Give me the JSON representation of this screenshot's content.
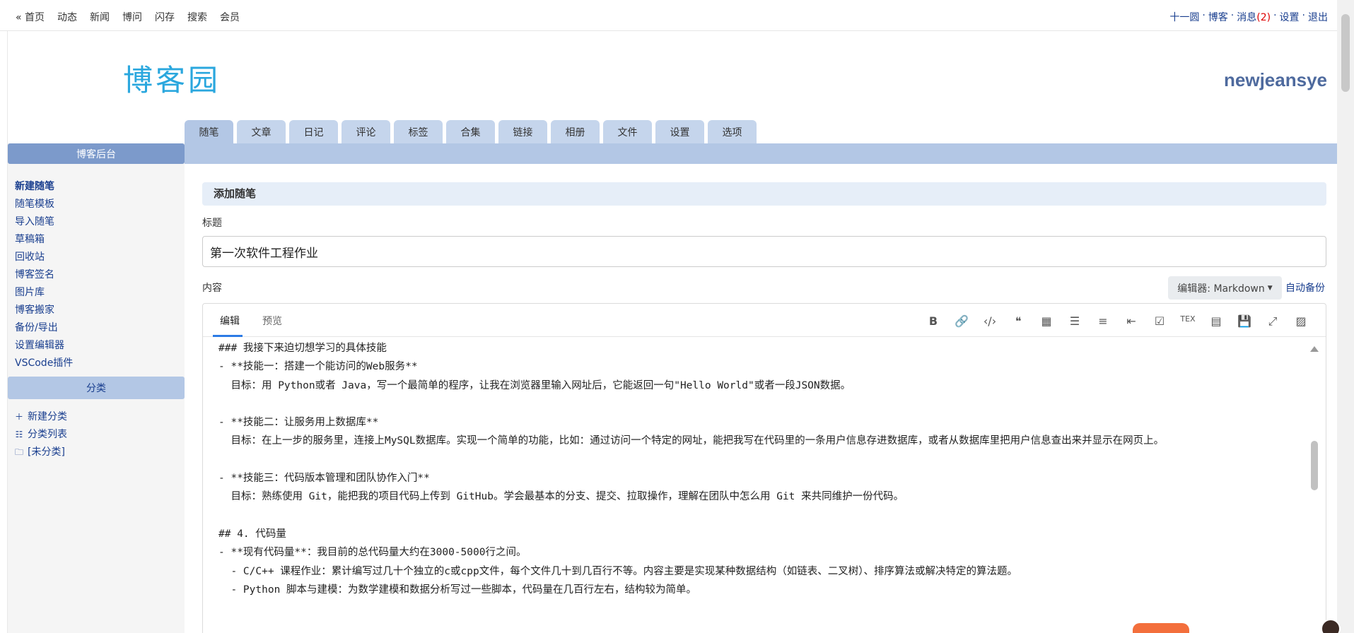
{
  "topbar": {
    "left": [
      "« 首页",
      "动态",
      "新闻",
      "博问",
      "闪存",
      "搜索",
      "会员"
    ],
    "right": {
      "user": "十一圆",
      "blog": "博客",
      "messages": "消息",
      "messages_count": "(2)",
      "settings": "设置",
      "logout": "退出",
      "sep": "·"
    }
  },
  "header": {
    "logo": "博客园",
    "username": "newjeansye"
  },
  "tabs": [
    "随笔",
    "文章",
    "日记",
    "评论",
    "标签",
    "合集",
    "链接",
    "相册",
    "文件",
    "设置",
    "选项"
  ],
  "sidebar": {
    "title": "博客后台",
    "links": [
      "新建随笔",
      "随笔模板",
      "导入随笔",
      "草稿箱",
      "回收站",
      "博客签名",
      "图片库",
      "博客搬家",
      "备份/导出",
      "设置编辑器",
      "VSCode插件"
    ],
    "category_title": "分类",
    "categories": [
      {
        "icon": "plus-icon",
        "label": "新建分类"
      },
      {
        "icon": "list-icon",
        "label": "分类列表"
      },
      {
        "icon": "folder-icon",
        "label": "[未分类]"
      }
    ]
  },
  "main": {
    "section_title": "添加随笔",
    "title_label": "标题",
    "title_value": "第一次软件工程作业",
    "content_label": "内容",
    "editor_select": "编辑器: Markdown",
    "autosave": "自动备份",
    "editor_tabs": [
      "编辑",
      "预览"
    ],
    "toolbar": [
      {
        "name": "bold-icon",
        "glyph": "B"
      },
      {
        "name": "link-icon",
        "glyph": "🔗"
      },
      {
        "name": "code-icon",
        "glyph": "‹/›"
      },
      {
        "name": "quote-icon",
        "glyph": "❝"
      },
      {
        "name": "table-icon",
        "glyph": "▦"
      },
      {
        "name": "unordered-list-icon",
        "glyph": "☰"
      },
      {
        "name": "ordered-list-icon",
        "glyph": "≡"
      },
      {
        "name": "indent-icon",
        "glyph": "⇤"
      },
      {
        "name": "task-list-icon",
        "glyph": "☑"
      },
      {
        "name": "tex-icon",
        "glyph": "TEX"
      },
      {
        "name": "toc-icon",
        "glyph": "▤"
      },
      {
        "name": "save-icon",
        "glyph": "💾"
      },
      {
        "name": "fullscreen-icon",
        "glyph": "⤢"
      },
      {
        "name": "image-icon",
        "glyph": "▨"
      }
    ],
    "content_lines": [
      "### 我接下来迫切想学习的具体技能",
      "- **技能一：搭建一个能访问的Web服务**",
      "  目标：用 Python或者 Java，写一个最简单的程序，让我在浏览器里输入网址后，它能返回一句\"Hello World\"或者一段JSON数据。",
      "",
      "- **技能二：让服务用上数据库**",
      "  目标：在上一步的服务里，连接上MySQL数据库。实现一个简单的功能，比如：通过访问一个特定的网址，能把我写在代码里的一条用户信息存进数据库，或者从数据库里把用户信息查出来并显示在网页上。",
      "",
      "- **技能三：代码版本管理和团队协作入门**",
      "  目标：熟练使用 Git，能把我的项目代码上传到 GitHub。学会最基本的分支、提交、拉取操作，理解在团队中怎么用 Git 来共同维护一份代码。",
      "",
      "## 4. 代码量",
      "- **现有代码量**：我目前的总代码量大约在3000-5000行之间。",
      "  - C/C++ 课程作业：累计编写过几十个独立的c或cpp文件，每个文件几十到几百行不等。内容主要是实现某种数据结构（如链表、二叉树）、排序算法或解决特定的算法题。",
      "  - Python 脚本与建模：为数学建模和数据分析写过一些脚本，代码量在几百行左右，结构较为简单。"
    ]
  }
}
